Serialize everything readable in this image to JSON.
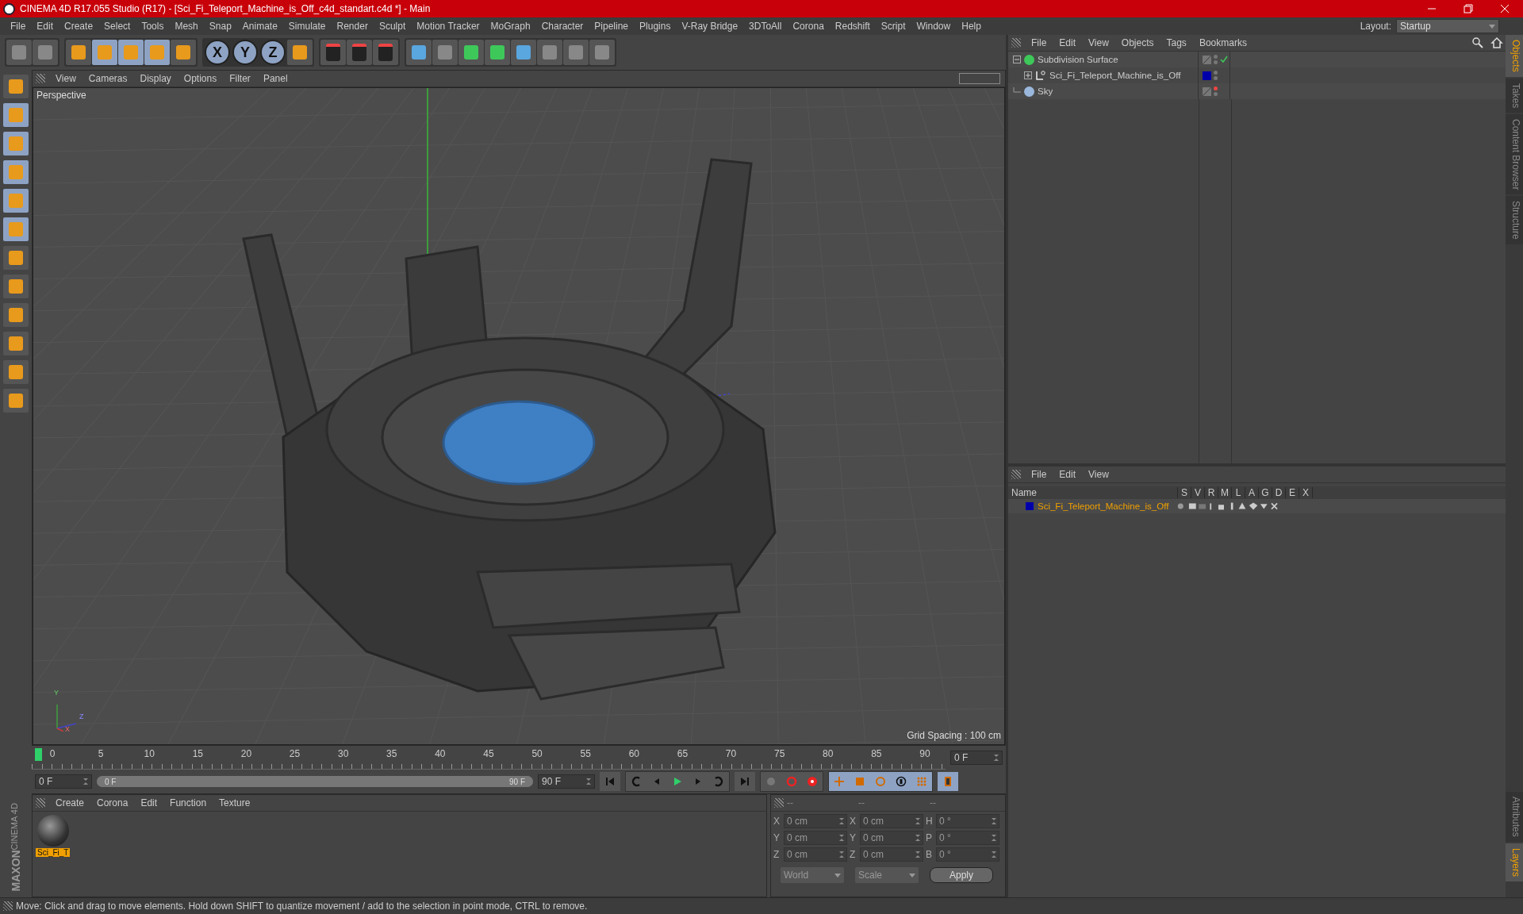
{
  "window": {
    "title": "CINEMA 4D R17.055 Studio (R17) - [Sci_Fi_Teleport_Machine_is_Off_c4d_standart.c4d *] - Main"
  },
  "menu": [
    "File",
    "Edit",
    "Create",
    "Select",
    "Tools",
    "Mesh",
    "Snap",
    "Animate",
    "Simulate",
    "Render",
    "Sculpt",
    "Motion Tracker",
    "MoGraph",
    "Character",
    "Pipeline",
    "Plugins",
    "V-Ray Bridge",
    "3DToAll",
    "Corona",
    "Redshift",
    "Script",
    "Window",
    "Help"
  ],
  "layout": {
    "label": "Layout:",
    "value": "Startup"
  },
  "toolbar": {
    "axis_buttons": [
      {
        "label": "X",
        "selected": true
      },
      {
        "label": "Y",
        "selected": true
      },
      {
        "label": "Z",
        "selected": true
      }
    ]
  },
  "viewport": {
    "menu": [
      "View",
      "Cameras",
      "Display",
      "Options",
      "Filter",
      "Panel"
    ],
    "camera": "Perspective",
    "grid_spacing": "Grid Spacing : 100 cm",
    "axis_labels": [
      "Y",
      "Z",
      "X"
    ]
  },
  "timeline": {
    "ticks": [
      "0",
      "5",
      "10",
      "15",
      "20",
      "25",
      "30",
      "35",
      "40",
      "45",
      "50",
      "55",
      "60",
      "65",
      "70",
      "75",
      "80",
      "85",
      "90"
    ],
    "current_frame": "0 F",
    "start_field": "0 F",
    "range_start": "0 F",
    "range_end": "90 F",
    "range": {
      "level": 1
    },
    "end_field": "90 F"
  },
  "material_manager": {
    "menu": [
      "Create",
      "Corona",
      "Edit",
      "Function",
      "Texture"
    ],
    "materials": [
      {
        "name": "Sci_Fi_T",
        "selected": true
      }
    ]
  },
  "coordinates": {
    "headers": [
      "--",
      "--",
      "--"
    ],
    "rows": [
      {
        "axis1": "X",
        "pos": "0 cm",
        "axis2": "X",
        "size": "0 cm",
        "axis3": "H",
        "rot": "0 °"
      },
      {
        "axis1": "Y",
        "pos": "0 cm",
        "axis2": "Y",
        "size": "0 cm",
        "axis3": "P",
        "rot": "0 °"
      },
      {
        "axis1": "Z",
        "pos": "0 cm",
        "axis2": "Z",
        "size": "0 cm",
        "axis3": "B",
        "rot": "0 °"
      }
    ],
    "space": "World",
    "mode": "Scale",
    "apply": "Apply"
  },
  "object_manager": {
    "menu": [
      "File",
      "Edit",
      "View",
      "Objects",
      "Tags",
      "Bookmarks"
    ],
    "objects": [
      {
        "name": "Subdivision Surface",
        "kind": "generator",
        "expanded": true,
        "editor_visible": true,
        "checkmark": true,
        "children": [
          {
            "name": "Sci_Fi_Teleport_Machine_is_Off",
            "kind": "null",
            "expanded": false,
            "editor_visible": true,
            "checkmark": false,
            "color": "#0000aa"
          }
        ]
      },
      {
        "name": "Sky",
        "kind": "sky",
        "expanded": false,
        "editor_visible": false,
        "checkmark": false
      }
    ]
  },
  "layer_manager": {
    "menu": [
      "File",
      "Edit",
      "View"
    ],
    "columns": [
      "Name",
      "S",
      "V",
      "R",
      "M",
      "L",
      "A",
      "G",
      "D",
      "E",
      "X"
    ],
    "layers": [
      {
        "name": "Sci_Fi_Teleport_Machine_is_Off",
        "color": "#0000aa",
        "selected": true
      }
    ]
  },
  "side_tabs_top": [
    {
      "label": "Objects",
      "selected": true
    },
    {
      "label": "Takes",
      "selected": false
    },
    {
      "label": "Content Browser",
      "selected": false
    },
    {
      "label": "Structure",
      "selected": false
    }
  ],
  "side_tabs_bottom": [
    {
      "label": "Attributes",
      "selected": false
    },
    {
      "label": "Layers",
      "selected": true
    }
  ],
  "logo": [
    "MAXON",
    "CINEMA 4D"
  ],
  "status_bar": "Move: Click and drag to move elements. Hold down SHIFT to quantize movement / add to the selection in point mode, CTRL to remove."
}
